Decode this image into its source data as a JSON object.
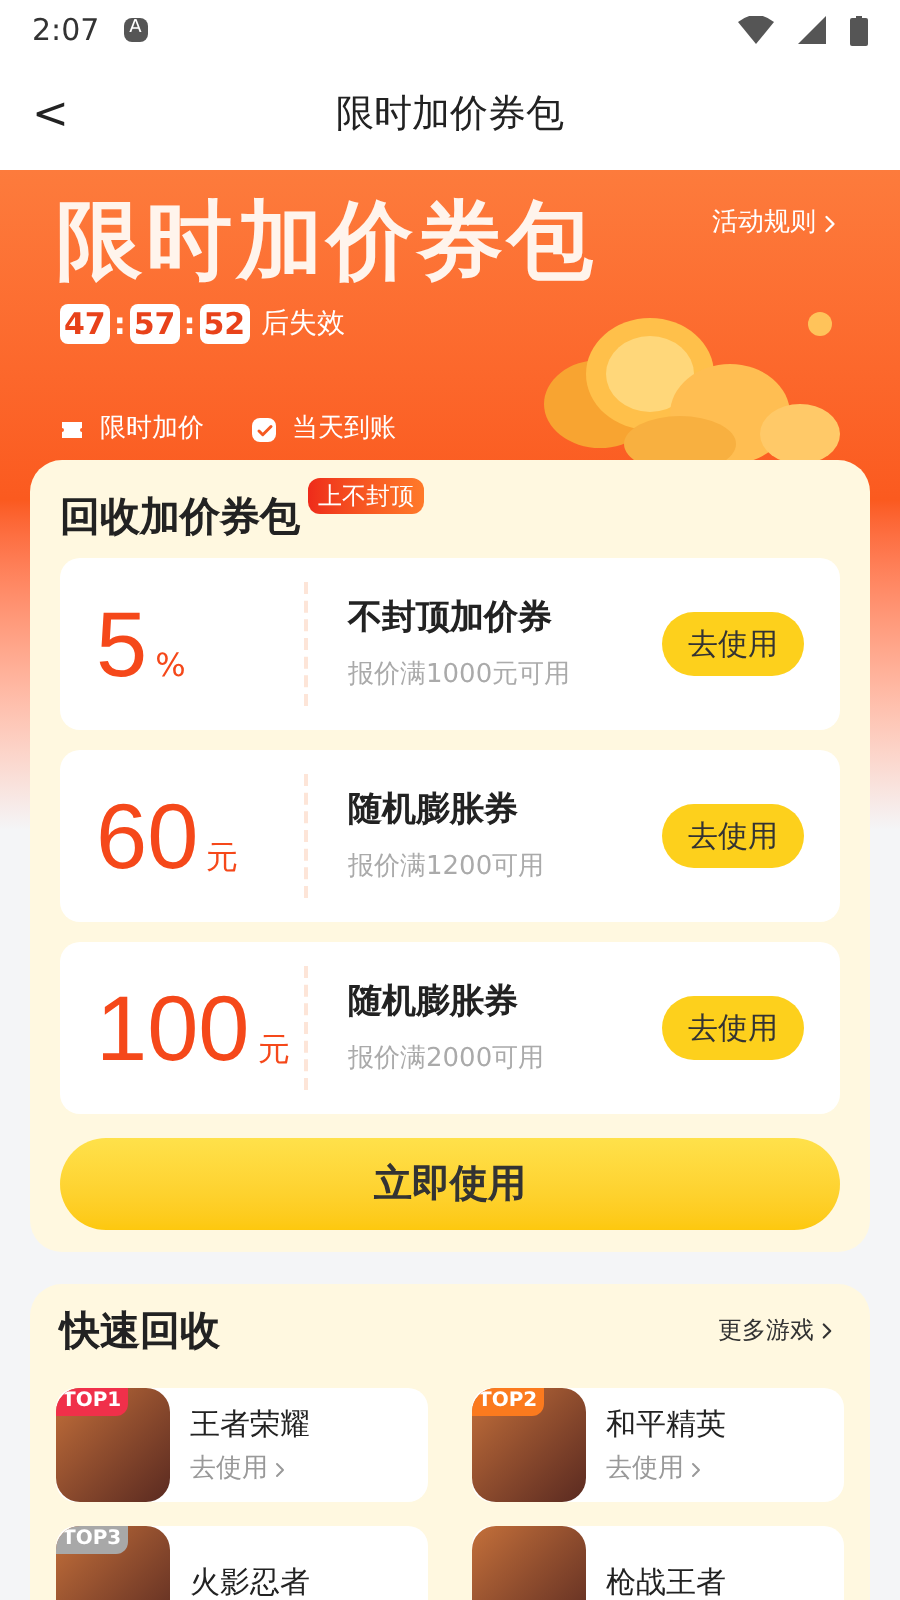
{
  "status_bar": {
    "time": "2:07",
    "notification": "A"
  },
  "header": {
    "back": "<",
    "title": "限时加价券包"
  },
  "banner": {
    "title": "限时加价券包",
    "rules_link": "活动规则",
    "countdown": [
      "47",
      "57",
      "52"
    ],
    "separator": ":",
    "countdown_suffix": "后失效",
    "features": [
      {
        "kind": "gift",
        "label": "限时加价"
      },
      {
        "kind": "check",
        "label": "当天到账"
      }
    ]
  },
  "coupon_pack": {
    "title": "回收加价券包",
    "tag": "上不封顶",
    "coupons": [
      {
        "amount": "5",
        "unit": "%",
        "name": "不封顶加价券",
        "condition": "报价满1000元可用",
        "action": "去使用"
      },
      {
        "amount": "60",
        "unit": "元",
        "name": "随机膨胀券",
        "condition": "报价满1200可用",
        "action": "去使用"
      },
      {
        "amount": "100",
        "unit": "元",
        "name": "随机膨胀券",
        "condition": "报价满2000可用",
        "action": "去使用"
      }
    ],
    "use_now": "立即使用"
  },
  "quick_recycle": {
    "title": "快速回收",
    "more": "更多游戏",
    "games": [
      {
        "rank": "TOP1",
        "color": "#f0304a",
        "name": "王者荣耀",
        "action": "去使用"
      },
      {
        "rank": "TOP2",
        "color": "#fb7a1e",
        "name": "和平精英",
        "action": "去使用"
      },
      {
        "rank": "TOP3",
        "color": "#a8a8a8",
        "name": "火影忍者"
      },
      {
        "name": "枪战王者"
      }
    ]
  }
}
